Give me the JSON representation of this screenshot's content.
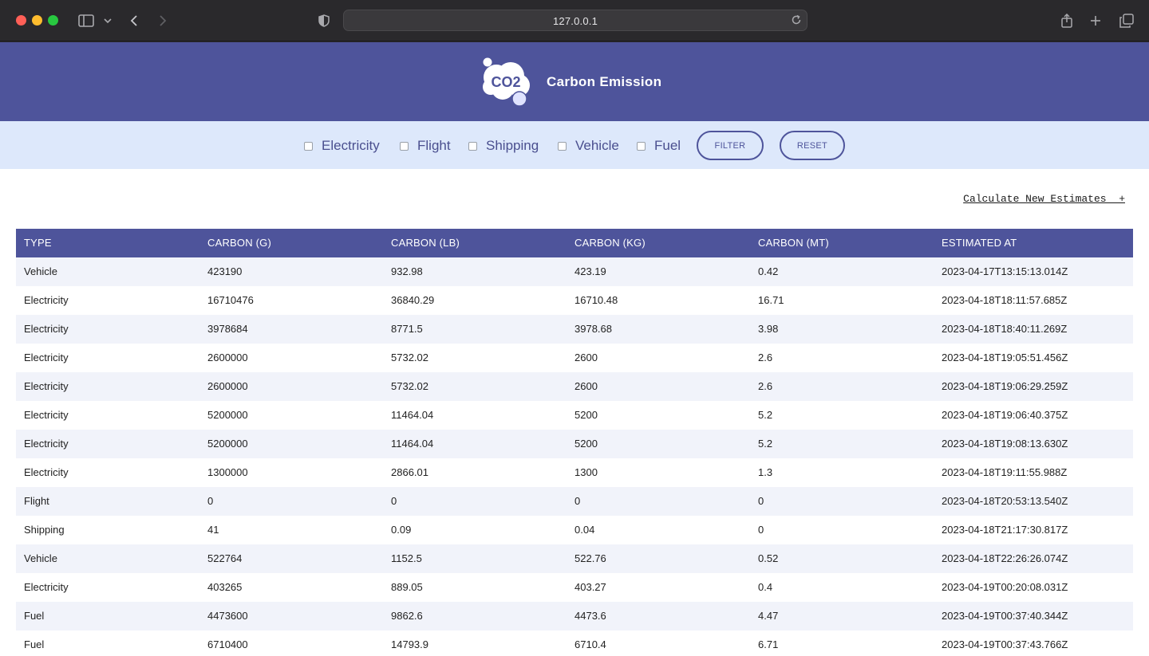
{
  "browser": {
    "url": "127.0.0.1"
  },
  "app": {
    "logo_text": "CO2",
    "title": "Carbon Emission"
  },
  "filters": {
    "options": [
      {
        "label": "Electricity",
        "checked": false
      },
      {
        "label": "Flight",
        "checked": false
      },
      {
        "label": "Shipping",
        "checked": false
      },
      {
        "label": "Vehicle",
        "checked": false
      },
      {
        "label": "Fuel",
        "checked": false
      }
    ],
    "filter_label": "FILTER",
    "reset_label": "RESET"
  },
  "calc_link": "Calculate New Estimates  +",
  "table": {
    "headers": [
      "TYPE",
      "CARBON (G)",
      "CARBON (LB)",
      "CARBON (KG)",
      "CARBON (MT)",
      "ESTIMATED AT"
    ],
    "rows": [
      [
        "Vehicle",
        "423190",
        "932.98",
        "423.19",
        "0.42",
        "2023-04-17T13:15:13.014Z"
      ],
      [
        "Electricity",
        "16710476",
        "36840.29",
        "16710.48",
        "16.71",
        "2023-04-18T18:11:57.685Z"
      ],
      [
        "Electricity",
        "3978684",
        "8771.5",
        "3978.68",
        "3.98",
        "2023-04-18T18:40:11.269Z"
      ],
      [
        "Electricity",
        "2600000",
        "5732.02",
        "2600",
        "2.6",
        "2023-04-18T19:05:51.456Z"
      ],
      [
        "Electricity",
        "2600000",
        "5732.02",
        "2600",
        "2.6",
        "2023-04-18T19:06:29.259Z"
      ],
      [
        "Electricity",
        "5200000",
        "11464.04",
        "5200",
        "5.2",
        "2023-04-18T19:06:40.375Z"
      ],
      [
        "Electricity",
        "5200000",
        "11464.04",
        "5200",
        "5.2",
        "2023-04-18T19:08:13.630Z"
      ],
      [
        "Electricity",
        "1300000",
        "2866.01",
        "1300",
        "1.3",
        "2023-04-18T19:11:55.988Z"
      ],
      [
        "Flight",
        "0",
        "0",
        "0",
        "0",
        "2023-04-18T20:53:13.540Z"
      ],
      [
        "Shipping",
        "41",
        "0.09",
        "0.04",
        "0",
        "2023-04-18T21:17:30.817Z"
      ],
      [
        "Vehicle",
        "522764",
        "1152.5",
        "522.76",
        "0.52",
        "2023-04-18T22:26:26.074Z"
      ],
      [
        "Electricity",
        "403265",
        "889.05",
        "403.27",
        "0.4",
        "2023-04-19T00:20:08.031Z"
      ],
      [
        "Fuel",
        "4473600",
        "9862.6",
        "4473.6",
        "4.47",
        "2023-04-19T00:37:40.344Z"
      ],
      [
        "Fuel",
        "6710400",
        "14793.9",
        "6710.4",
        "6.71",
        "2023-04-19T00:37:43.766Z"
      ]
    ]
  },
  "colors": {
    "brand": "#4e549b",
    "filter_bg": "#dde8fb",
    "row_stripe": "#f1f3fa"
  }
}
